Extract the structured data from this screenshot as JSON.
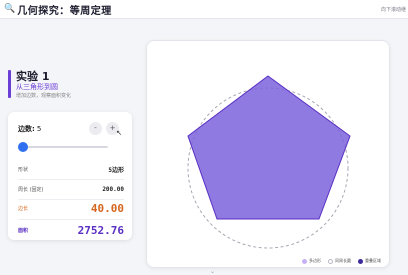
{
  "header": {
    "icon": "magnifier-icon",
    "title": "几何探究：等周定理",
    "hint": "向下滚动继"
  },
  "experiment": {
    "number": "实验 1",
    "subtitle": "从三角形到圆",
    "description": "增加边数，观察面积变化"
  },
  "controls": {
    "sides_label": "边数:",
    "sides_value": "5",
    "minus_label": "-",
    "plus_label": "+",
    "slider_fraction": 0.0
  },
  "stats": {
    "shape_label": "形状",
    "shape_value": "5边形",
    "perimeter_label": "周长 (固定)",
    "perimeter_value": "200.00",
    "side_label": "边长",
    "side_value": "40.00",
    "area_label": "面积",
    "area_value": "2752.76"
  },
  "legend": {
    "items": [
      {
        "label": "多边形",
        "color": "#c6b2f2"
      },
      {
        "label": "同周长圆",
        "color": "#ffffff"
      },
      {
        "label": "重叠区域",
        "color": "#3b2a9a"
      }
    ]
  },
  "colors": {
    "accent": "#6b3fd6",
    "polygon_fill": "#7b63dc",
    "circle_stroke": "#a8a8b4",
    "side_highlight": "#d4661f",
    "slider_thumb": "#2f6ff0"
  },
  "scroll_icon": "chevron-down-icon"
}
